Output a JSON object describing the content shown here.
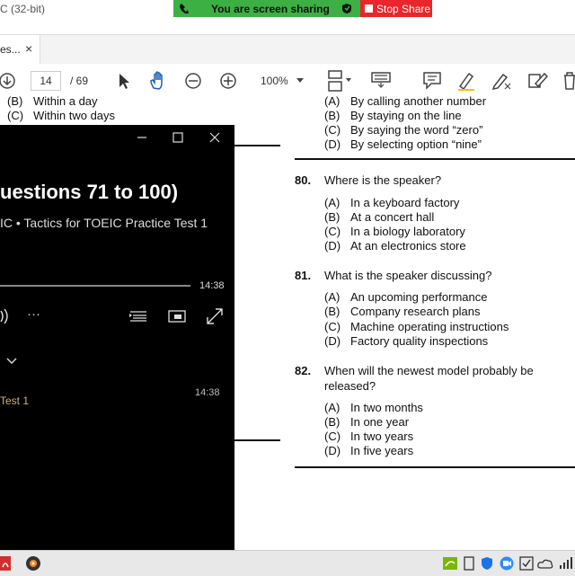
{
  "window": {
    "title": "C (32-bit)"
  },
  "sharing": {
    "status": "You are screen sharing",
    "stop_label": "Stop Share"
  },
  "tab": {
    "label": "es...",
    "close": "×"
  },
  "toolbar": {
    "page_current": "14",
    "page_total": "/ 69",
    "zoom": "100%"
  },
  "document": {
    "prev_q_tail": [
      {
        "letter": "(B)",
        "text": "Within a day"
      },
      {
        "letter": "(C)",
        "text": "Within two days"
      }
    ],
    "q79_tail": [
      {
        "letter": "(A)",
        "text": "By calling another number"
      },
      {
        "letter": "(B)",
        "text": "By staying on the line"
      },
      {
        "letter": "(C)",
        "text": "By saying the word “zero”"
      },
      {
        "letter": "(D)",
        "text": "By selecting option “nine”"
      }
    ],
    "questions": [
      {
        "number": "80.",
        "text": "Where is the speaker?",
        "options": [
          {
            "letter": "(A)",
            "text": "In a keyboard factory"
          },
          {
            "letter": "(B)",
            "text": "At a concert hall"
          },
          {
            "letter": "(C)",
            "text": "In a biology laboratory"
          },
          {
            "letter": "(D)",
            "text": "At an electronics store"
          }
        ]
      },
      {
        "number": "81.",
        "text": "What is the speaker discussing?",
        "options": [
          {
            "letter": "(A)",
            "text": "An upcoming performance"
          },
          {
            "letter": "(B)",
            "text": "Company research plans"
          },
          {
            "letter": "(C)",
            "text": "Machine operating instructions"
          },
          {
            "letter": "(D)",
            "text": "Factory quality inspections"
          }
        ]
      },
      {
        "number": "82.",
        "text_line1": "When will the newest model probably be",
        "text_line2": "released?",
        "options": [
          {
            "letter": "(A)",
            "text": "In two months"
          },
          {
            "letter": "(B)",
            "text": "In one year"
          },
          {
            "letter": "(C)",
            "text": "In two years"
          },
          {
            "letter": "(D)",
            "text": "In five years"
          }
        ]
      }
    ]
  },
  "player": {
    "title": "uestions 71 to 100)",
    "subtitle": "IC • Tactics for TOEIC Practice Test 1",
    "time": "14:38",
    "track_label": "Test 1",
    "track_time": "14:38",
    "more": "···"
  }
}
